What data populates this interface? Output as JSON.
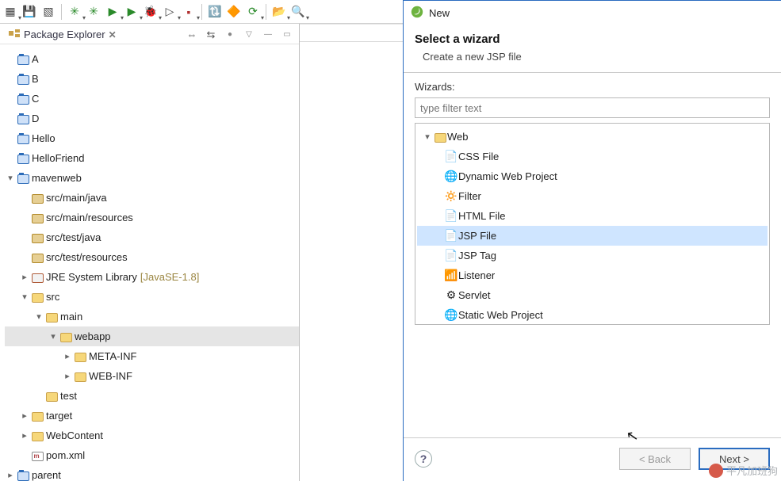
{
  "toolbar": {
    "icons": [
      "▦",
      "💾",
      "▧",
      "✳",
      "✳",
      "▶",
      "▶",
      "🐞",
      "▶",
      "▇",
      "🔃",
      "🔶",
      "📂",
      "🔍",
      "▦",
      "▦",
      "▦",
      "●",
      "▦",
      "▦",
      "▦",
      "▦",
      "◷",
      "▦",
      "●",
      "●"
    ]
  },
  "pkg": {
    "title": "Package Explorer",
    "close": "✕"
  },
  "tree": [
    {
      "ind": 0,
      "exp": "",
      "icon": "proj",
      "label": "A"
    },
    {
      "ind": 0,
      "exp": "",
      "icon": "proj",
      "label": "B"
    },
    {
      "ind": 0,
      "exp": "",
      "icon": "proj",
      "label": "C"
    },
    {
      "ind": 0,
      "exp": "",
      "icon": "proj",
      "label": "D"
    },
    {
      "ind": 0,
      "exp": "",
      "icon": "proj",
      "label": "Hello"
    },
    {
      "ind": 0,
      "exp": "",
      "icon": "proj",
      "label": "HelloFriend"
    },
    {
      "ind": 0,
      "exp": "▾",
      "icon": "proj-open",
      "label": "mavenweb"
    },
    {
      "ind": 1,
      "exp": "",
      "icon": "sf",
      "label": "src/main/java"
    },
    {
      "ind": 1,
      "exp": "",
      "icon": "sf",
      "label": "src/main/resources"
    },
    {
      "ind": 1,
      "exp": "",
      "icon": "sf",
      "label": "src/test/java"
    },
    {
      "ind": 1,
      "exp": "",
      "icon": "sf",
      "label": "src/test/resources"
    },
    {
      "ind": 1,
      "exp": "▸",
      "icon": "lib",
      "label": "JRE System Library",
      "suffix": "[JavaSE-1.8]"
    },
    {
      "ind": 1,
      "exp": "▾",
      "icon": "fld",
      "label": "src"
    },
    {
      "ind": 2,
      "exp": "▾",
      "icon": "fld",
      "label": "main"
    },
    {
      "ind": 3,
      "exp": "▾",
      "icon": "fld",
      "label": "webapp",
      "sel": true
    },
    {
      "ind": 4,
      "exp": "▸",
      "icon": "fld",
      "label": "META-INF"
    },
    {
      "ind": 4,
      "exp": "▸",
      "icon": "fld",
      "label": "WEB-INF"
    },
    {
      "ind": 2,
      "exp": "",
      "icon": "fld",
      "label": "test"
    },
    {
      "ind": 1,
      "exp": "▸",
      "icon": "fld",
      "label": "target"
    },
    {
      "ind": 1,
      "exp": "▸",
      "icon": "fld",
      "label": "WebContent"
    },
    {
      "ind": 1,
      "exp": "",
      "icon": "xml",
      "label": "pom.xml"
    },
    {
      "ind": 0,
      "exp": "▸",
      "icon": "proj",
      "label": "parent"
    }
  ],
  "dialog": {
    "title": "New",
    "heading": "Select a wizard",
    "sub": "Create a new JSP file",
    "wizards_label": "Wizards:",
    "filter_placeholder": "type filter text",
    "tree": {
      "root": "Web",
      "items": [
        {
          "label": "CSS File",
          "ico": "📄"
        },
        {
          "label": "Dynamic Web Project",
          "ico": "🌐"
        },
        {
          "label": "Filter",
          "ico": "🔅"
        },
        {
          "label": "HTML File",
          "ico": "📄"
        },
        {
          "label": "JSP File",
          "ico": "📄",
          "sel": true
        },
        {
          "label": "JSP Tag",
          "ico": "📄"
        },
        {
          "label": "Listener",
          "ico": "📶"
        },
        {
          "label": "Servlet",
          "ico": "⚙"
        },
        {
          "label": "Static Web Project",
          "ico": "🌐"
        }
      ]
    },
    "buttons": {
      "back": "< Back",
      "next": "Next >"
    },
    "help": "?"
  },
  "watermark": "平凡加班狗"
}
